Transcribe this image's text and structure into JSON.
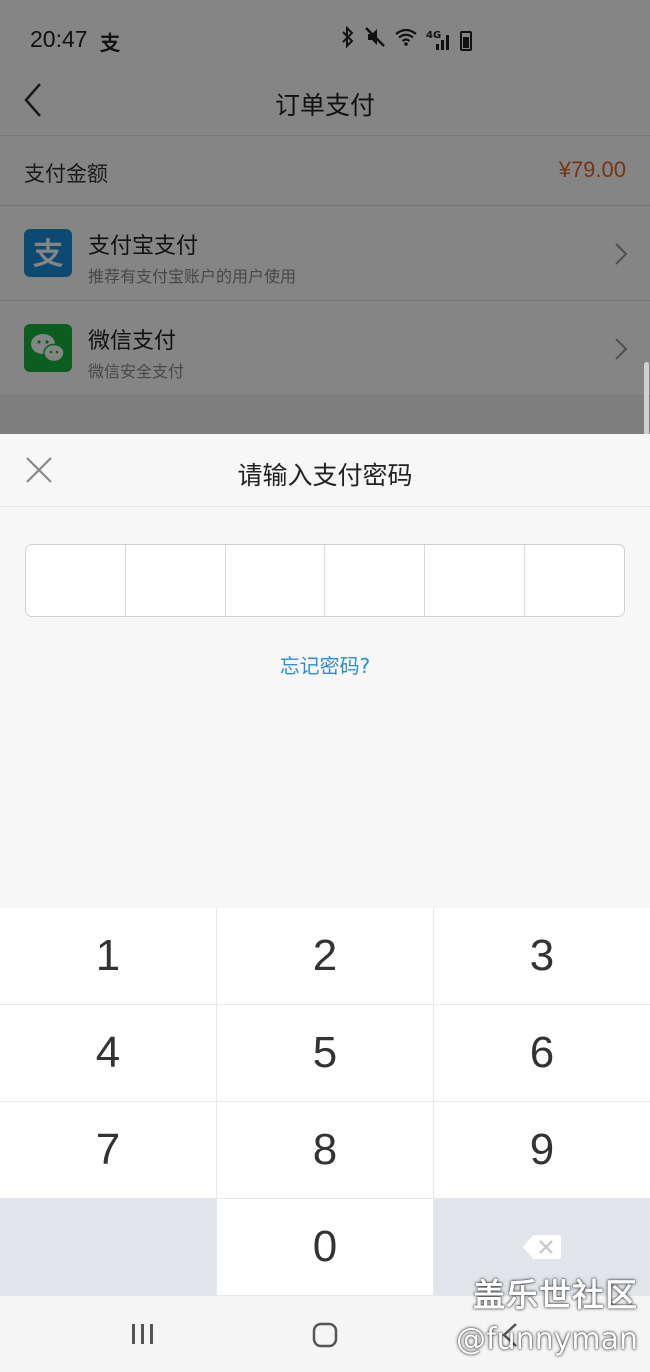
{
  "status_bar": {
    "time": "20:47",
    "notify_icon": "支",
    "icons": [
      "bluetooth-icon",
      "mute-icon",
      "wifi-icon",
      "signal-4g-icon",
      "battery-icon"
    ],
    "signal_label": "4G"
  },
  "nav": {
    "title": "订单支付"
  },
  "order": {
    "amount_label": "支付金额",
    "amount_value": "¥79.00"
  },
  "payment_methods": [
    {
      "name": "支付宝支付",
      "subtitle": "推荐有支付宝账户的用户使用",
      "icon": "alipay-icon",
      "color": "#1a8fd8"
    },
    {
      "name": "微信支付",
      "subtitle": "微信安全支付",
      "icon": "wechat-icon",
      "color": "#16b53b"
    }
  ],
  "password_sheet": {
    "title": "请输入支付密码",
    "pin_length": 6,
    "forgot_label": "忘记密码?"
  },
  "keypad": {
    "keys": [
      "1",
      "2",
      "3",
      "4",
      "5",
      "6",
      "7",
      "8",
      "9",
      "",
      "0",
      "⌫"
    ]
  },
  "watermark": {
    "line1": "盖乐世社区",
    "line2": "@funnyman"
  },
  "colors": {
    "accent": "#e0672a",
    "link": "#2b8fd4"
  }
}
